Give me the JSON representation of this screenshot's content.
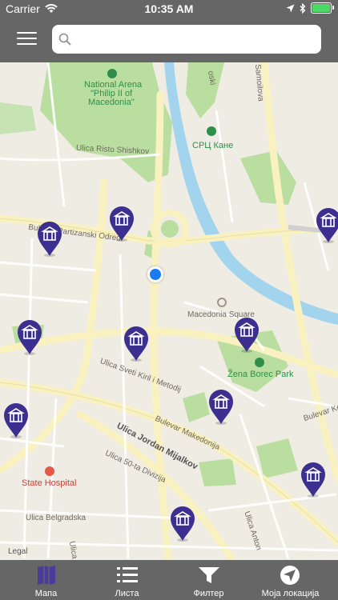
{
  "status_bar": {
    "carrier": "Carrier",
    "time": "10:35 AM"
  },
  "search": {
    "value": "",
    "placeholder": ""
  },
  "map": {
    "labels": {
      "national_arena_line1": "National Arena",
      "national_arena_line2": "\"Philip II of",
      "national_arena_line3": "Macedonia\"",
      "src_kane": "СРЦ Кане",
      "ulica_risto": "Ulica Risto Shishkov",
      "partizanski": "Bulevar Partizanski Odredi",
      "macedonia_square": "Macedonia Square",
      "zena_borec_park": "Žena Borec Park",
      "sveti_kiril": "Ulica Sveti Kiril i Metodij",
      "bulevar_makedonija": "Bulevar Makedonija",
      "jordan_mijalkov": "Ulica Jordan Mijalkov",
      "divizija": "Ulica 50-ta Divizija",
      "state_hospital": "State Hospital",
      "belgradska": "Ulica Belgradska",
      "antonie": "Ulica Anton",
      "samoilova": "Samoilova",
      "bulevar_koco": "Bulevar Koc",
      "oski": "oski",
      "ulica_short": "Ulica"
    },
    "legal": "Legal"
  },
  "tabs": [
    {
      "label": "Мапа",
      "icon": "map-icon"
    },
    {
      "label": "Листа",
      "icon": "list-icon"
    },
    {
      "label": "Филтер",
      "icon": "filter-icon"
    },
    {
      "label": "Моја локација",
      "icon": "location-arrow-icon"
    }
  ],
  "colors": {
    "header": "#666666",
    "marker": "#3d2f8f",
    "active_tab_icon": "#4a3a9a",
    "river": "#a3d4ee",
    "park": "#b9dea0",
    "road": "#fbf3c0",
    "user_location": "#1a7cf5"
  }
}
